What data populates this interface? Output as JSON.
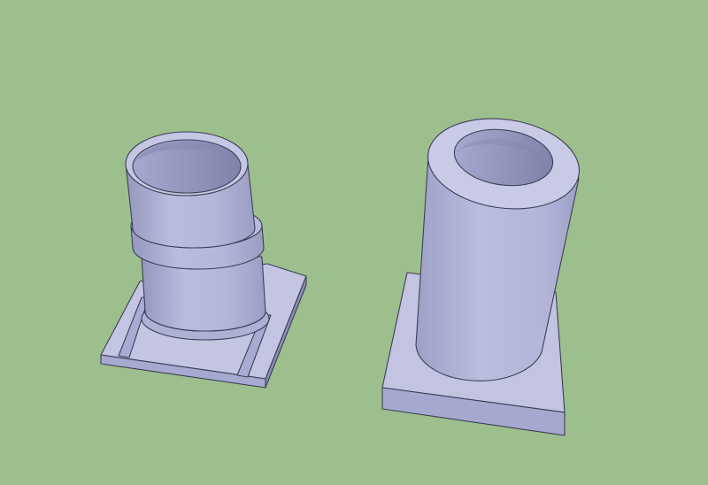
{
  "viewport": {
    "background": "#9dbf8d",
    "edge_color": "#3c3f55"
  },
  "models": [
    {
      "name": "stepped-cylinder-on-base",
      "face_colors": {
        "light": "#c7c9e4",
        "mid": "#aeb1d3",
        "dark": "#8d90b5",
        "inner": "#9a9dc4"
      }
    },
    {
      "name": "tube-on-base",
      "face_colors": {
        "light": "#c9cbe6",
        "mid": "#b0b3d6",
        "dark": "#8e91b8",
        "inner": "#9c9fc5"
      }
    }
  ]
}
